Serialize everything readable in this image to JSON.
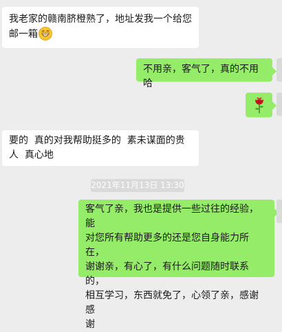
{
  "messages": [
    {
      "side": "left",
      "text_line1": "我老家的赣南脐橙熟了，地址发我一个给您",
      "text_line2": "邮一箱",
      "emoji": "grinning-emoji"
    },
    {
      "side": "right",
      "text": "不用亲，客气了，真的不用哈"
    },
    {
      "side": "right",
      "emoji": "rose-emoji"
    },
    {
      "side": "left",
      "text_line1": "要的  真的对我帮助挺多的  素未谋面的贵",
      "text_line2": "人  真心地"
    },
    {
      "side": "right",
      "lines": [
        "客气了亲，我也是提供一些过往的经验，能",
        "对您所有帮助更多的还是您自身能力所在，",
        "谢谢亲，有心了，有什么问题随时联系的，",
        "相互学习，东西就免了，心领了亲，感谢感",
        "谢"
      ]
    }
  ],
  "timestamp": "2021年11月13日 13:30",
  "colors": {
    "background": "#ededed",
    "left_bubble": "#ffffff",
    "right_bubble": "#95ec69",
    "timestamp_bg": "#dadada"
  }
}
